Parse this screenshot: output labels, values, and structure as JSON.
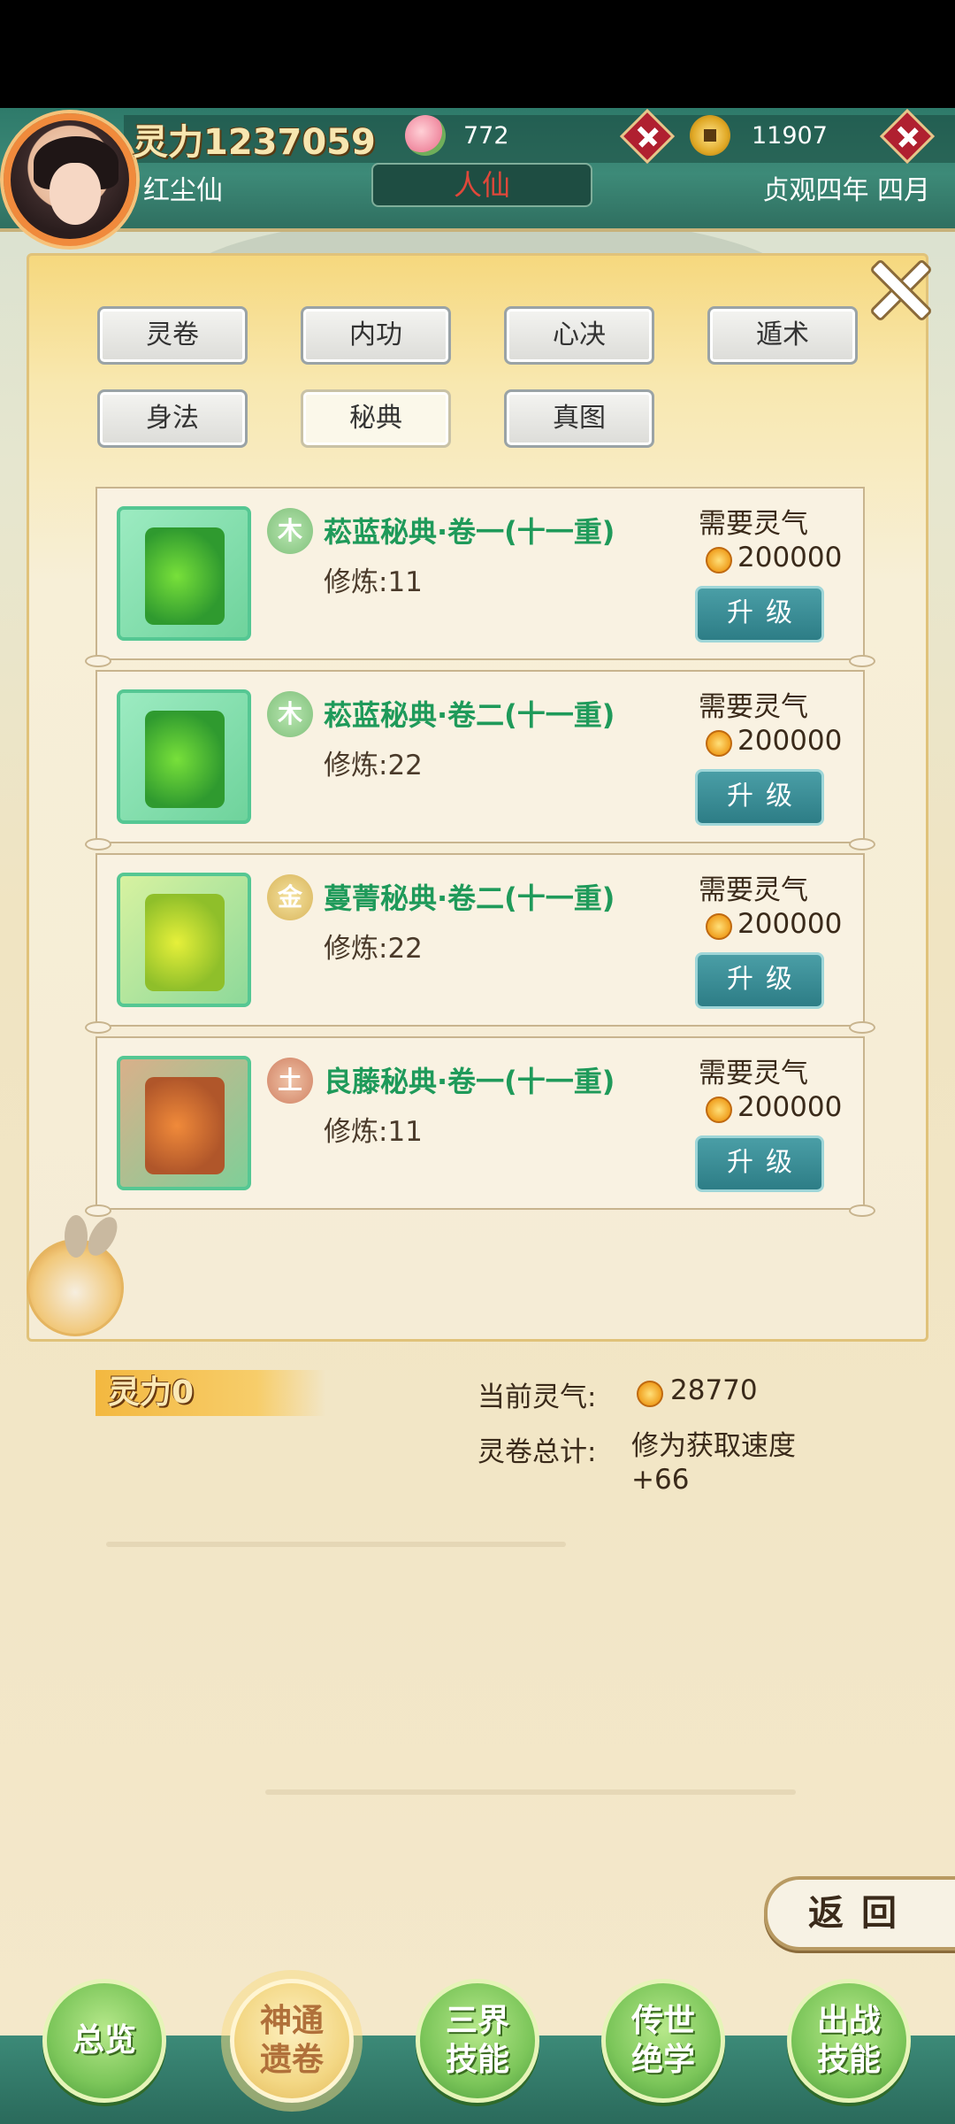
{
  "header": {
    "power_label": "灵力1237059",
    "peach_count": "772",
    "coin_count": "11907",
    "player_name": "红尘仙",
    "rank": "人仙",
    "date": "贞观四年 四月"
  },
  "tabs": [
    {
      "label": "灵卷",
      "active": false
    },
    {
      "label": "内功",
      "active": false
    },
    {
      "label": "心决",
      "active": false
    },
    {
      "label": "遁术",
      "active": false
    },
    {
      "label": "身法",
      "active": false
    },
    {
      "label": "秘典",
      "active": true
    },
    {
      "label": "真图",
      "active": false
    }
  ],
  "cards": [
    {
      "scroll_label": "卷一",
      "element": "木",
      "title": "菘蓝秘典·卷一(十一重)",
      "level": "修炼:11",
      "need_label": "需要灵气",
      "cost": "200000",
      "button": "升级"
    },
    {
      "scroll_label": "卷二",
      "element": "木",
      "title": "菘蓝秘典·卷二(十一重)",
      "level": "修炼:22",
      "need_label": "需要灵气",
      "cost": "200000",
      "button": "升级"
    },
    {
      "scroll_label": "卷二",
      "element": "金",
      "title": "蔓菁秘典·卷二(十一重)",
      "level": "修炼:22",
      "need_label": "需要灵气",
      "cost": "200000",
      "button": "升级"
    },
    {
      "scroll_label": "卷一",
      "element": "土",
      "title": "良藤秘典·卷一(十一重)",
      "level": "修炼:11",
      "need_label": "需要灵气",
      "cost": "200000",
      "button": "升级"
    }
  ],
  "footer": {
    "power_label": "灵力0",
    "current_label": "当前灵气:",
    "current_value": "28770",
    "total_label": "灵卷总计:",
    "total_value": "修为获取速度 +66"
  },
  "back_button": "返回",
  "nav": [
    {
      "label": "总览",
      "active": false
    },
    {
      "label": "神通遗卷",
      "active": true
    },
    {
      "label": "三界技能",
      "active": false
    },
    {
      "label": "传世绝学",
      "active": false
    },
    {
      "label": "出战技能",
      "active": false
    }
  ],
  "colors": {
    "header_bg": "#2e7a6a",
    "title_green": "#1f9a5a",
    "button_teal": "#2d7d86",
    "rank_red": "#e0483a"
  }
}
